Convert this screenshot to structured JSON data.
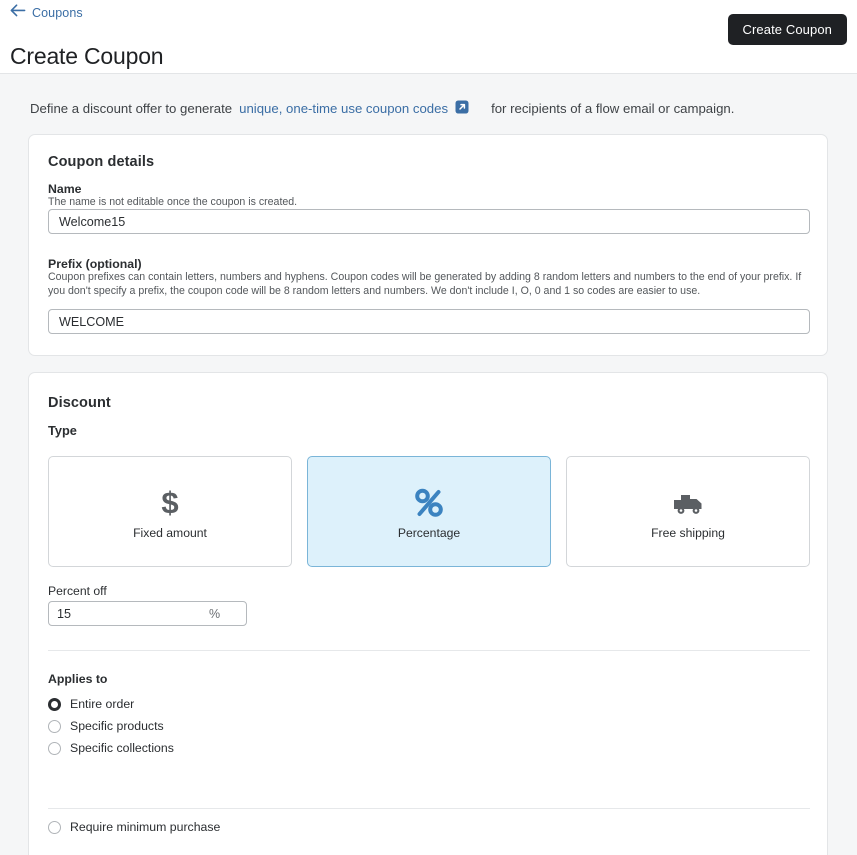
{
  "header": {
    "back_label": "Coupons",
    "back_icon": "arrow-left-icon",
    "title": "Create Coupon",
    "primary_button": "Create Coupon"
  },
  "intro": {
    "lead": "Define a discount offer to generate",
    "link_text": "unique, one-time use coupon codes",
    "link_icon": "external-link-icon",
    "trail": "for recipients of a flow email or campaign."
  },
  "coupon_details": {
    "title": "Coupon details",
    "name": {
      "label": "Name",
      "help": "The name is not editable once the coupon is created.",
      "value": "Welcome15",
      "placeholder": ""
    },
    "prefix": {
      "label": "Prefix (optional)",
      "help": "Coupon prefixes can contain letters, numbers and hyphens. Coupon codes will be generated by adding 8 random letters and numbers to the end of your prefix. If you don't specify a prefix, the coupon code will be 8 random letters and numbers. We don't include I, O, 0 and 1 so codes are easier to use.",
      "value": "WELCOME",
      "placeholder": ""
    }
  },
  "discount": {
    "title": "Discount",
    "type_label": "Type",
    "types": [
      {
        "label": "Fixed amount",
        "icon": "dollar-sign-icon",
        "selected": false
      },
      {
        "label": "Percentage",
        "icon": "percent-icon",
        "selected": true
      },
      {
        "label": "Free shipping",
        "icon": "truck-icon",
        "selected": false
      }
    ],
    "percent_off": {
      "label": "Percent off",
      "value": "15",
      "suffix": "%"
    },
    "applies_to": {
      "label": "Applies to",
      "options": [
        {
          "label": "Entire order",
          "selected": true
        },
        {
          "label": "Specific products",
          "selected": false
        },
        {
          "label": "Specific collections",
          "selected": false
        }
      ]
    },
    "require_minimum": {
      "label": "Require minimum purchase",
      "checked": false
    }
  },
  "colors": {
    "accent_blue": "#3b6ea5",
    "selected_card_bg": "#ddf1fb",
    "selected_card_border": "#7ab5d8",
    "primary_button_bg": "#1f2124",
    "page_bg": "#f5f6f7",
    "icon_gray": "#5b5f63"
  }
}
